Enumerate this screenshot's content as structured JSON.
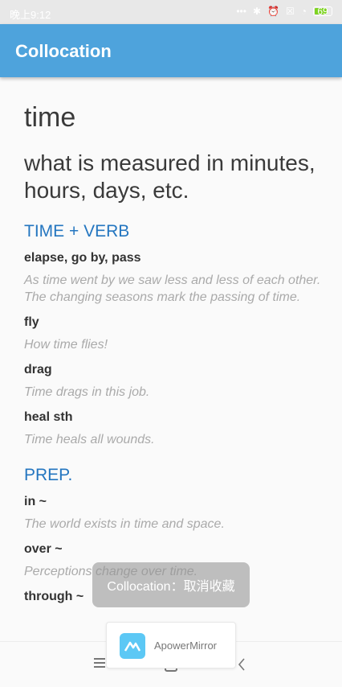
{
  "status_bar": {
    "time": "晚上9:12",
    "battery_level": "69",
    "icons": [
      "dots-icon",
      "bluetooth-icon",
      "alarm-icon",
      "sim-icon",
      "wifi-icon",
      "battery-icon"
    ]
  },
  "app_bar": {
    "title": "Collocation"
  },
  "entry": {
    "word": "time",
    "definition": "what is measured in minutes, hours, days, etc.",
    "sections": [
      {
        "heading": "TIME + VERB",
        "items": [
          {
            "phrase": "elapse, go by, pass",
            "example": "As time went by we saw less and less of each other. The changing seasons mark the passing of time."
          },
          {
            "phrase": "fly",
            "example": "How time flies!"
          },
          {
            "phrase": "drag",
            "example": "Time drags in this job."
          },
          {
            "phrase": "heal sth",
            "example": "Time heals all wounds."
          }
        ]
      },
      {
        "heading": "PREP.",
        "items": [
          {
            "phrase": "in ~",
            "example": "The world exists in time and space."
          },
          {
            "phrase": "over ~",
            "example": "Perceptions change over time."
          },
          {
            "phrase": "through ~",
            "example": ""
          }
        ]
      }
    ]
  },
  "toast": {
    "message": "Collocation：取消收藏"
  },
  "overlay": {
    "apowermirror_label": "ApowerMirror"
  },
  "colors": {
    "app_bar": "#4ea3dc",
    "section_heading": "#2476c0",
    "example_text": "#aaaaaa"
  }
}
